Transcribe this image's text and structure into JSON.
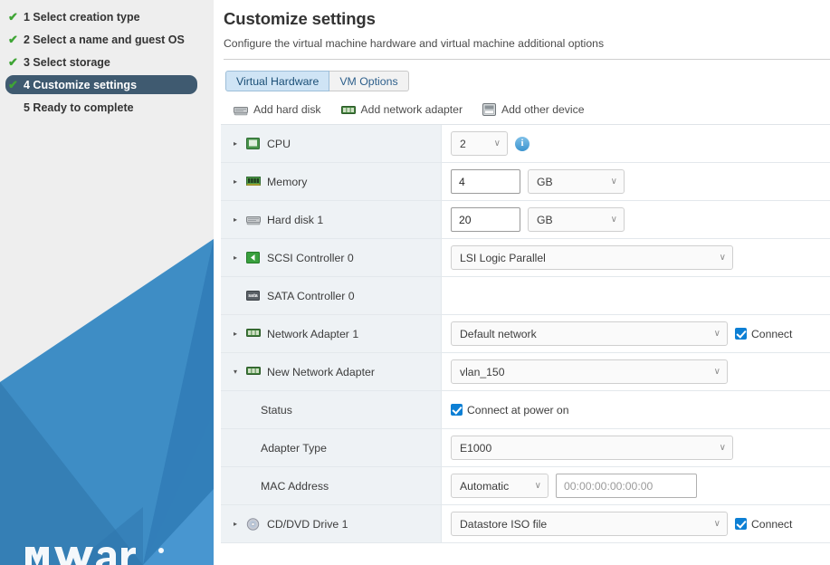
{
  "wizard": {
    "steps": [
      {
        "num": "1",
        "label": "1 Select creation type",
        "checked": true,
        "active": false
      },
      {
        "num": "2",
        "label": "2 Select a name and guest OS",
        "checked": true,
        "active": false
      },
      {
        "num": "3",
        "label": "3 Select storage",
        "checked": true,
        "active": false
      },
      {
        "num": "4",
        "label": "4 Customize settings",
        "checked": true,
        "active": true
      },
      {
        "num": "5",
        "label": "5 Ready to complete",
        "checked": false,
        "active": false
      }
    ],
    "brand": "vmware"
  },
  "header": {
    "title": "Customize settings",
    "subtitle": "Configure the virtual machine hardware and virtual machine additional options"
  },
  "tabs": [
    {
      "label": "Virtual Hardware",
      "selected": true
    },
    {
      "label": "VM Options",
      "selected": false
    }
  ],
  "toolbar": [
    {
      "label": "Add hard disk",
      "icon": "hard-disk-icon"
    },
    {
      "label": "Add network adapter",
      "icon": "network-adapter-icon"
    },
    {
      "label": "Add other device",
      "icon": "other-device-icon"
    }
  ],
  "devices": [
    {
      "name": "CPU",
      "icon": "cpu-icon",
      "caret": "collapsed",
      "value": "2",
      "info": "i",
      "deletable": false
    },
    {
      "name": "Memory",
      "icon": "memory-icon",
      "caret": "collapsed",
      "value": "4",
      "unit": "GB",
      "deletable": false
    },
    {
      "name": "Hard disk 1",
      "icon": "hard-disk-icon",
      "caret": "collapsed",
      "value": "20",
      "unit": "GB",
      "deletable": true
    },
    {
      "name": "SCSI Controller 0",
      "icon": "scsi-icon",
      "caret": "collapsed",
      "value": "LSI Logic Parallel",
      "deletable": true
    },
    {
      "name": "SATA Controller 0",
      "icon": "sata-icon",
      "caret": "none",
      "value": "",
      "deletable": true
    },
    {
      "name": "Network Adapter 1",
      "icon": "network-adapter-icon",
      "caret": "collapsed",
      "value": "Default network",
      "connect_label": "Connect",
      "connect_checked": true,
      "deletable": true
    },
    {
      "name": "New Network Adapter",
      "icon": "network-adapter-icon",
      "caret": "expanded",
      "value": "vlan_150",
      "deletable": true
    },
    {
      "name": "Status",
      "sub": true,
      "checkbox_label": "Connect at power on",
      "checkbox_checked": true
    },
    {
      "name": "Adapter Type",
      "sub": true,
      "value": "E1000"
    },
    {
      "name": "MAC Address",
      "sub": true,
      "mode": "Automatic",
      "mac": "00:00:00:00:00:00"
    },
    {
      "name": "CD/DVD Drive 1",
      "icon": "cddvd-icon",
      "caret": "collapsed",
      "value": "Datastore ISO file",
      "connect_label": "Connect",
      "connect_checked": true,
      "deletable": true
    }
  ],
  "glyphs": {
    "check": "✔",
    "caret_right": "▸",
    "caret_down": "▾",
    "chevron_down": "∨",
    "close": "✕"
  },
  "colors": {
    "accent": "#3f5a70",
    "check_green": "#3fa535",
    "tab_selected": "#cfe4f5",
    "label_col": "#eef2f5",
    "checkbox_blue": "#0d7fd4",
    "brand_blue": "#2a7fc0"
  }
}
